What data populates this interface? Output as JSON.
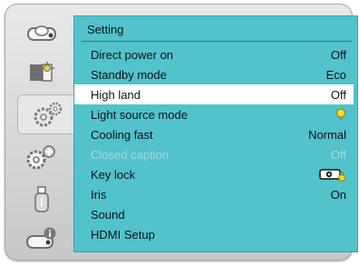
{
  "menu": {
    "title": "Setting",
    "items": [
      {
        "label": "Direct power on",
        "value": "Off"
      },
      {
        "label": "Standby mode",
        "value": "Eco"
      },
      {
        "label": "High land",
        "value": "Off",
        "selected": true
      },
      {
        "label": "Light source mode",
        "value_icon": "bulb-icon"
      },
      {
        "label": "Cooling fast",
        "value": "Normal"
      },
      {
        "label": "Closed caption",
        "value": "Off",
        "disabled": true
      },
      {
        "label": "Key lock",
        "value_icon": "projector-lock-icon"
      },
      {
        "label": "Iris",
        "value": "On"
      },
      {
        "label": "Sound",
        "value": ""
      },
      {
        "label": "HDMI Setup",
        "value": ""
      }
    ]
  },
  "sidebar": {
    "items": [
      {
        "icon": "display-icon"
      },
      {
        "icon": "picture-adjust-icon"
      },
      {
        "icon": "setting-gears-icon",
        "active": true
      },
      {
        "icon": "expanded-setting-icon"
      },
      {
        "icon": "usb-memory-icon"
      },
      {
        "icon": "information-icon"
      }
    ]
  },
  "colors": {
    "panel": "#52c2cb",
    "selected_row": "#ffffff",
    "disabled_text": "#a6dadf",
    "frame": "#d8d8d8"
  }
}
